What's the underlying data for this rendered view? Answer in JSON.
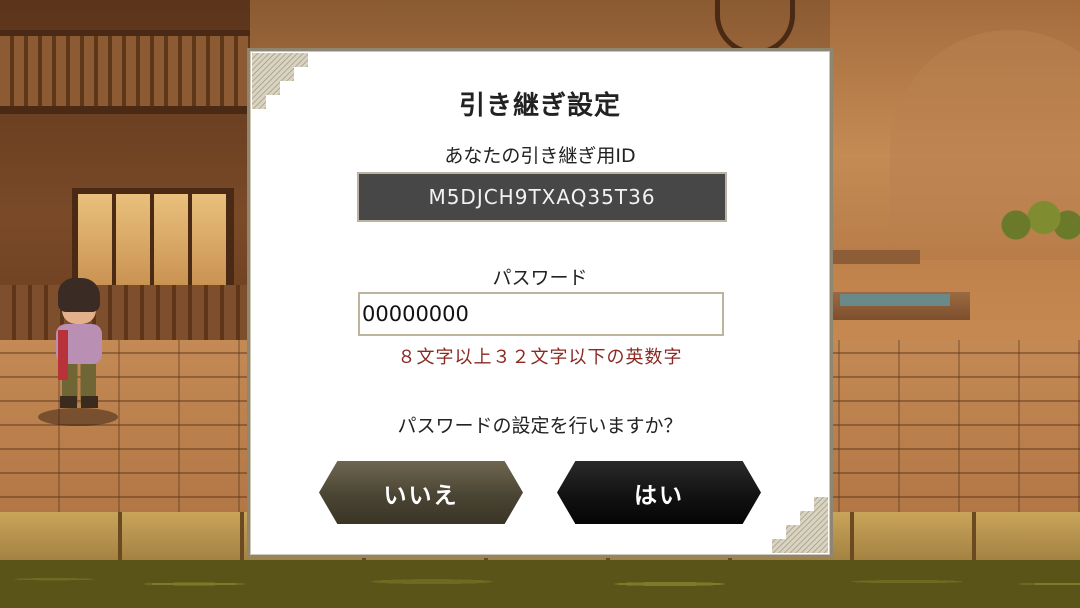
{
  "dialog": {
    "title": "引き継ぎ設定",
    "id_label": "あなたの引き継ぎ用ID",
    "id_value": "M5DJCH9TXAQ35T36",
    "password_label": "パスワード",
    "password_value": "00000000",
    "password_hint": "８文字以上３２文字以下の英数字",
    "question": "パスワードの設定を行いますか？",
    "buttons": {
      "no_label": "いいえ",
      "yes_label": "はい"
    }
  },
  "colors": {
    "id_box_bg": "#474747",
    "hint_text": "#8a2a22",
    "no_button": "#5a5340",
    "yes_button": "#111111",
    "dialog_border": "#8f8672"
  },
  "icons": [
    "corner-ornament-icon"
  ]
}
